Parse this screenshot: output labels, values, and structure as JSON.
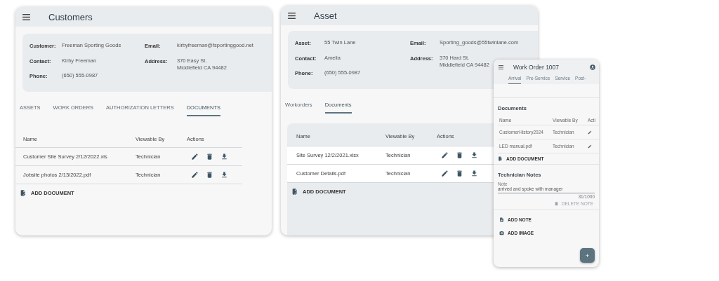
{
  "customers": {
    "title": "Customers",
    "left_fields": [
      {
        "label": "Customer:",
        "lines": [
          "Freeman Sporting Goods"
        ]
      },
      {
        "label": "Contact:",
        "lines": [
          "Kirby Freeman"
        ]
      },
      {
        "label": "Phone:",
        "lines": [
          "(650) 555-0987"
        ]
      }
    ],
    "right_fields": [
      {
        "label": "Email:",
        "lines": [
          "kirbyfreeman@fsportinggood.net"
        ]
      },
      {
        "label": "Address:",
        "lines": [
          "370 Easy St.",
          "Middlefield CA 94482"
        ]
      }
    ],
    "tabs": [
      {
        "label": "ASSETS",
        "selected": false
      },
      {
        "label": "WORK ORDERS",
        "selected": false
      },
      {
        "label": "AUTHORIZATION LETTERS",
        "selected": false
      },
      {
        "label": "DOCUMENTS",
        "selected": true
      }
    ],
    "columns": [
      "Name",
      "Viewable By",
      "Actions"
    ],
    "rows": [
      {
        "name": "Customer Site Survey 2/12/2022.xls",
        "viewable_by": "Technician"
      },
      {
        "name": "Jobsite photos 2/13/2022.pdf",
        "viewable_by": "Technician"
      }
    ],
    "add_button": "ADD DOCUMENT"
  },
  "asset": {
    "title": "Asset",
    "left_fields": [
      {
        "label": "Asset:",
        "lines": [
          "55 Twin Lane"
        ]
      },
      {
        "label": "Contact:",
        "lines": [
          "Amelia"
        ]
      },
      {
        "label": "Phone:",
        "lines": [
          "(650) 555-0987"
        ]
      }
    ],
    "right_fields": [
      {
        "label": "Email:",
        "lines": [
          "Sporting_goods@55twinlane.com"
        ]
      },
      {
        "label": "Address:",
        "lines": [
          "370 Hard St.",
          "Middlefield CA 94482"
        ]
      }
    ],
    "tabs": [
      {
        "label": "Workorders",
        "selected": false
      },
      {
        "label": "Documents",
        "selected": true
      }
    ],
    "columns": [
      "Name",
      "Viewable By",
      "Actions"
    ],
    "rows": [
      {
        "name": "Site Survey 12/2/2021.xlsx",
        "viewable_by": "Technician"
      },
      {
        "name": "Customer Details.pdf",
        "viewable_by": "Technician"
      }
    ],
    "add_button": "ADD DOCUMENT"
  },
  "work_order": {
    "title": "Work Order 1007",
    "tabs": [
      {
        "label": "Arrival",
        "selected": true
      },
      {
        "label": "Pre-Service",
        "selected": false
      },
      {
        "label": "Service",
        "selected": false
      },
      {
        "label": "Post-",
        "selected": false
      }
    ],
    "documents_heading": "Documents",
    "columns": [
      "Name",
      "Viewable By",
      "Acti"
    ],
    "rows": [
      {
        "name": "CustomerHistory2024",
        "viewable_by": "Technician"
      },
      {
        "name": "LED manual.pdf",
        "viewable_by": "Technician"
      }
    ],
    "add_button": "ADD DOCUMENT",
    "notes_heading": "Technician Notes",
    "note_field": {
      "label": "Note",
      "value": "arrived and spoke with manager",
      "counter": "31/1000"
    },
    "delete_note": {
      "label": "DELETE NOTE",
      "disabled": true
    },
    "actions": [
      {
        "kind": "note",
        "label": "ADD NOTE"
      },
      {
        "kind": "image",
        "label": "ADD IMAGE"
      }
    ],
    "fab": "+"
  }
}
